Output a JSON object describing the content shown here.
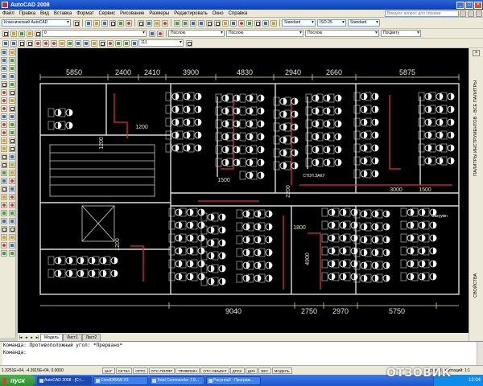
{
  "window": {
    "title": "AutoCAD 2008",
    "controls": [
      "_",
      "□",
      "×"
    ]
  },
  "menu": {
    "items": [
      "Файл",
      "Правка",
      "Вид",
      "Вставка",
      "Формат",
      "Сервис",
      "Рисование",
      "Размеры",
      "Редактировать",
      "Окно",
      "Справка"
    ],
    "help_placeholder": "Введите вопрос для справки"
  },
  "toolbar": {
    "workspace": "Классический AutoCAD",
    "text_style": "Standard",
    "dim_style": "ISO-25",
    "table_style": "Standard",
    "layer": "0",
    "color": "Послою",
    "linetype": "Послою",
    "lineweight": "Послою",
    "plot_style": "ПоЦвету",
    "scale": "111"
  },
  "drawing": {
    "dimensions_top": [
      "5850",
      "2400",
      "2410",
      "3900",
      "4830",
      "2940",
      "2660",
      "5875"
    ],
    "dimensions_bottom": [
      "9040",
      "2750",
      "2970",
      "5750"
    ],
    "dimensions_inner": [
      "1500",
      "2200",
      "3000",
      "1500",
      "1800",
      "4900",
      "1200",
      "1200",
      "1200"
    ],
    "room_labels": [
      "СТОЛ.ЗАКУ",
      "Ш",
      "С"
    ],
    "side_label": "Вакуумн"
  },
  "layout_tabs": [
    "Модель",
    "Лист1",
    "Лист2"
  ],
  "palette": {
    "close": "×",
    "tool_palettes": "ПАЛИТРЫ ИНСТРУМЕНТОВ - ВСЕ ПАЛИТРЫ",
    "properties": "СВОЙСТВА"
  },
  "command_line": {
    "line1": "Команда: Противоположный угол: *Прервано*",
    "line2": "Команда:"
  },
  "status": {
    "coords": "1.3251E+04, -4.3915E+04, 0.0000",
    "toggles": [
      "ШАГ",
      "СЕТКА",
      "ОРТО",
      "ОТС-ПОЛЯР",
      "ПРИВЯЗКА",
      "ОТС-ОБЪЕКТ",
      "ДПСК",
      "ДИН",
      "ВЕС",
      "МОДЕЛЬ"
    ],
    "annotation_scale": "Масштаб аннотаций: 1:1"
  },
  "taskbar": {
    "start": "пуск",
    "tasks": [
      "AutoCAD 2008 - [C:\\...",
      "CorelDRAW X3",
      "Total Commander 7.5...",
      "Рисунок3 - Програм..."
    ],
    "clock": "12:04"
  },
  "watermark": "ОТЗОВИК"
}
